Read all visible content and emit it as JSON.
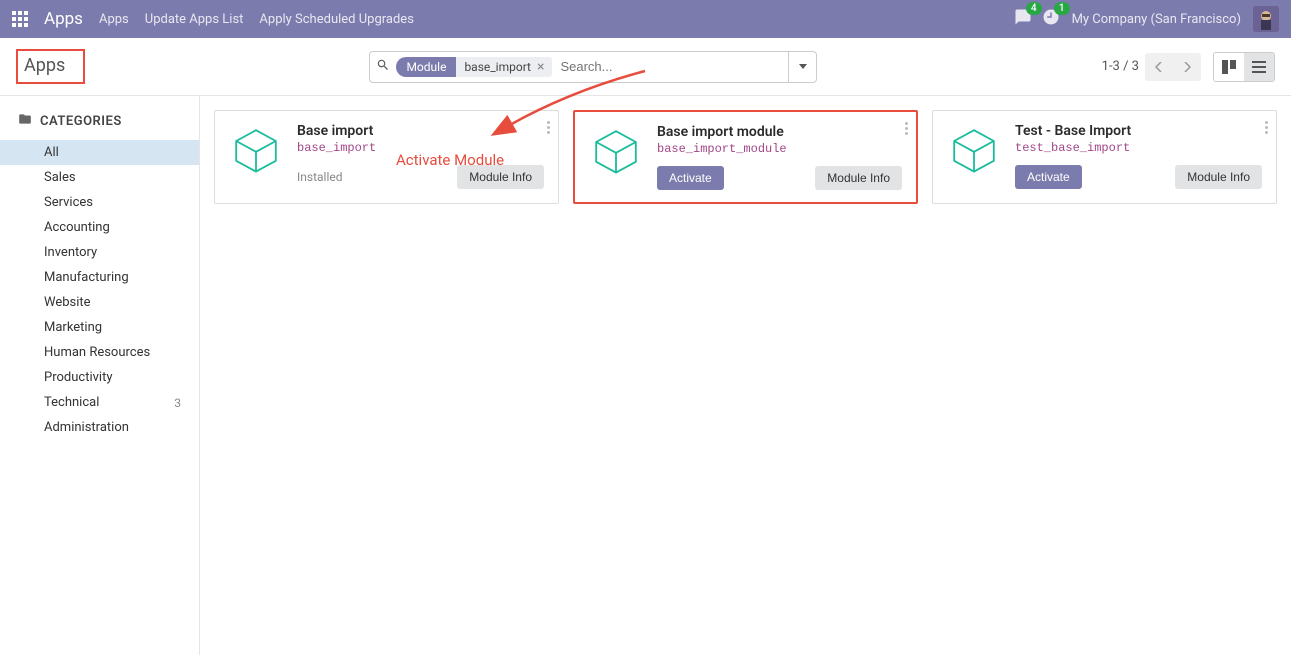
{
  "navbar": {
    "title": "Apps",
    "menu": [
      "Apps",
      "Update Apps List",
      "Apply Scheduled Upgrades"
    ],
    "messages_badge": "4",
    "activities_badge": "1",
    "company": "My Company (San Francisco)"
  },
  "breadcrumb": "Apps",
  "search": {
    "facet_label": "Module",
    "facet_value": "base_import",
    "placeholder": "Search..."
  },
  "pager": "1-3 / 3",
  "sidebar": {
    "header": "CATEGORIES",
    "items": [
      {
        "label": "All",
        "active": true
      },
      {
        "label": "Sales"
      },
      {
        "label": "Services"
      },
      {
        "label": "Accounting"
      },
      {
        "label": "Inventory"
      },
      {
        "label": "Manufacturing"
      },
      {
        "label": "Website"
      },
      {
        "label": "Marketing"
      },
      {
        "label": "Human Resources"
      },
      {
        "label": "Productivity"
      },
      {
        "label": "Technical",
        "count": "3"
      },
      {
        "label": "Administration"
      }
    ]
  },
  "cards": [
    {
      "title": "Base import",
      "tech": "base_import",
      "status": "Installed",
      "info_label": "Module Info",
      "activate_label": null,
      "highlight": false
    },
    {
      "title": "Base import module",
      "tech": "base_import_module",
      "status": null,
      "info_label": "Module Info",
      "activate_label": "Activate",
      "highlight": true
    },
    {
      "title": "Test - Base Import",
      "tech": "test_base_import",
      "status": null,
      "info_label": "Module Info",
      "activate_label": "Activate",
      "highlight": false
    }
  ],
  "annotation": "Activate Module"
}
